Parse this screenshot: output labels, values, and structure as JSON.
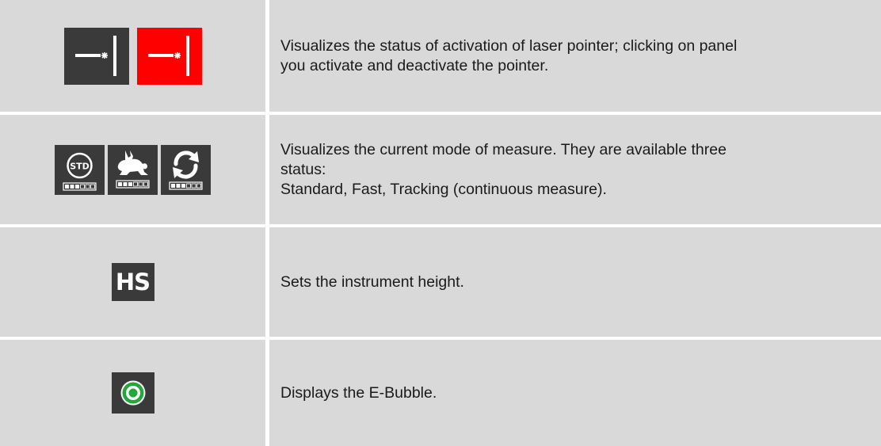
{
  "rows": [
    {
      "icons": [
        "laser-pointer-off-icon",
        "laser-pointer-on-icon"
      ],
      "description_lines": [
        "Visualizes the status of activation of laser pointer; clicking on panel",
        "you activate and deactivate the pointer."
      ]
    },
    {
      "icons": [
        "measure-standard-icon",
        "measure-fast-icon",
        "measure-tracking-icon"
      ],
      "std_label": "STD",
      "description_lines": [
        "Visualizes the current mode of measure. They are available three",
        "status:",
        "Standard, Fast, Tracking (continuous measure)."
      ]
    },
    {
      "icons": [
        "instrument-height-icon"
      ],
      "hs_label": "HS",
      "description_lines": [
        "Sets the instrument height."
      ]
    },
    {
      "icons": [
        "e-bubble-icon"
      ],
      "description_lines": [
        "Displays the E-Bubble."
      ]
    }
  ],
  "colors": {
    "cell_bg": "#d9d9d9",
    "tile_bg": "#3a3a3a",
    "laser_on": "#ff0000",
    "bubble_green": "#22a83a"
  }
}
